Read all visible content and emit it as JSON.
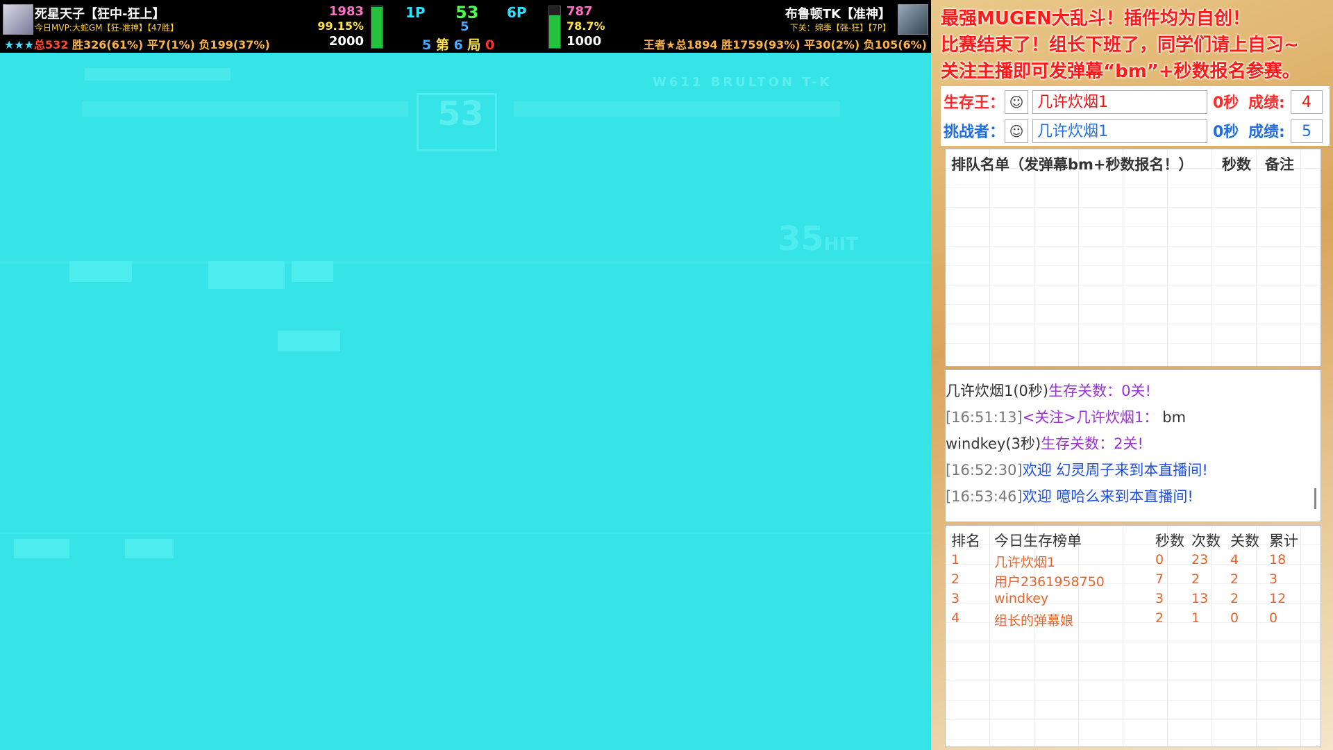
{
  "colors": {
    "game_bg": "#36e3e6",
    "banner_red": "#ff1a1a",
    "label_red": "#ff2a2a",
    "label_blue": "#1f6fe0",
    "lb_orange": "#e8622b",
    "green_bar": "#22c33a"
  },
  "hud": {
    "p1": {
      "name": "死星天子【狂中-狂上】",
      "mvp": "今日MVP:大蛇GM【狂-准神】【47胜】",
      "stars": "★★★",
      "total": "总532",
      "wins": "胜326(61%)",
      "draws": "平7(1%)",
      "losses": "负199(37%)",
      "score_top": "1983",
      "percent": "99.15%",
      "score_bottom": "2000",
      "life_fraction": 0.99
    },
    "center": {
      "p1_label": "1P",
      "timer": "53",
      "p2_label": "6P",
      "mid_number": "5",
      "round_left": "5",
      "round_text1": "第",
      "round_num": "6",
      "round_text2": "局",
      "round_right": "0"
    },
    "p2": {
      "name": "布鲁顿TK【准神】",
      "next": "下关：绵季【强-狂】【7P】",
      "record": "王者★总1894 胜1759(93%) 平30(2%) 负105(6%)",
      "score_top": "787",
      "percent": "78.7%",
      "score_bottom": "1000",
      "life_fraction": 0.79
    }
  },
  "game_ghosts": {
    "timer": "53",
    "combo": "35",
    "combo_suffix": "HIT",
    "p2_name": "W611 BRULTON T-K"
  },
  "panel": {
    "banner": [
      "最强MUGEN大乱斗！插件均为自创！",
      "比赛结束了！组长下班了，同学们请上自习~",
      "关注主播即可发弹幕“bm”+秒数报名参赛。"
    ],
    "survivor": {
      "label": "生存王：",
      "name": "几许炊烟1",
      "seconds": "0秒",
      "result_label": "成绩:",
      "score": "4"
    },
    "challenger": {
      "label": "挑战者：",
      "name": "几许炊烟1",
      "seconds": "0秒",
      "result_label": "成绩:",
      "score": "5"
    },
    "queue": {
      "col_title": "排队名单（发弹幕bm+秒数报名！）",
      "col_seconds": "秒数",
      "col_note": "备注"
    },
    "chat": [
      {
        "a": "几许炊烟1(0秒)",
        "b": "生存关数：0关!",
        "c": ""
      },
      {
        "a": "[16:51:13]",
        "b": "<关注>几许炊烟1：",
        "c": "bm"
      },
      {
        "a": "windkey(3秒)",
        "b": "生存关数：2关!",
        "c": ""
      },
      {
        "a": "[16:52:30]",
        "b": "欢迎 幻灵周子",
        "c": "来到本直播间!"
      },
      {
        "a": "[16:53:46]",
        "b": "欢迎 噫哈么",
        "c": "来到本直播间!"
      }
    ],
    "leaderboard": {
      "headers": {
        "rank": "排名",
        "title": "今日生存榜单",
        "seconds": "秒数",
        "times": "次数",
        "levels": "关数",
        "total": "累计"
      },
      "rows": [
        {
          "rank": "1",
          "name": "几许炊烟1",
          "seconds": "0",
          "times": "23",
          "levels": "4",
          "total": "18"
        },
        {
          "rank": "2",
          "name": "用户2361958750",
          "seconds": "7",
          "times": "2",
          "levels": "2",
          "total": "3"
        },
        {
          "rank": "3",
          "name": "windkey",
          "seconds": "3",
          "times": "13",
          "levels": "2",
          "total": "12"
        },
        {
          "rank": "4",
          "name": "组长的弹幕娘",
          "seconds": "2",
          "times": "1",
          "levels": "0",
          "total": "0"
        }
      ]
    }
  }
}
